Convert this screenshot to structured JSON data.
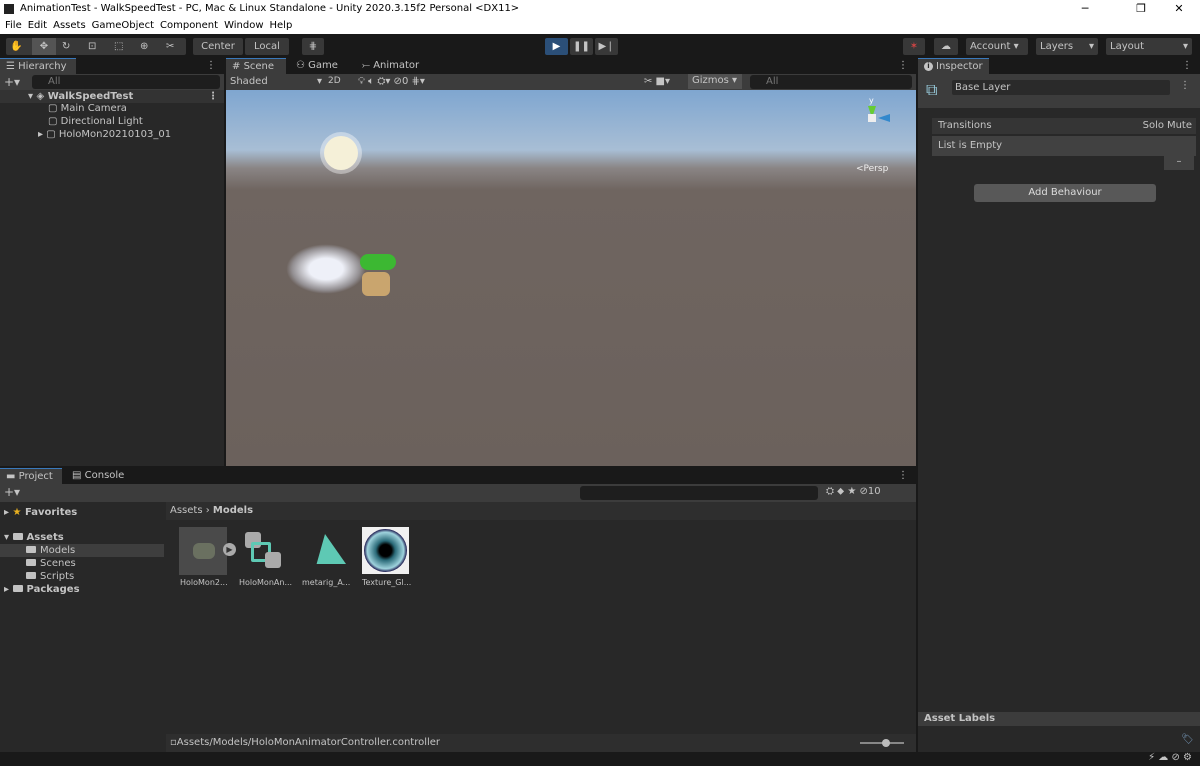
{
  "window": {
    "title": "AnimationTest - WalkSpeedTest - PC, Mac & Linux Standalone - Unity 2020.3.15f2 Personal <DX11>"
  },
  "menu": [
    "File",
    "Edit",
    "Assets",
    "GameObject",
    "Component",
    "Window",
    "Help"
  ],
  "toolbar": {
    "center": "Center",
    "local": "Local",
    "account": "Account",
    "layers": "Layers",
    "layout": "Layout"
  },
  "hierarchy": {
    "tab": "Hierarchy",
    "search_placeholder": "All",
    "scene": "WalkSpeedTest",
    "items": [
      "Main Camera",
      "Directional Light",
      "HoloMon20210103_01"
    ]
  },
  "scene": {
    "tabs": [
      "Scene",
      "Game",
      "Animator"
    ],
    "shading": "Shaded",
    "mode_2d": "2D",
    "hidden_count": "0",
    "gizmos": "Gizmos",
    "search_placeholder": "All",
    "persp": "<Persp",
    "gizmo_axis": "y"
  },
  "inspector": {
    "tab": "Inspector",
    "layer_name": "Base Layer",
    "transitions": "Transitions",
    "solo": "Solo",
    "mute": "Mute",
    "list_empty": "List is Empty",
    "minus": "–",
    "add_behaviour": "Add Behaviour",
    "asset_labels": "Asset Labels"
  },
  "project": {
    "tabs": [
      "Project",
      "Console"
    ],
    "favorites": "Favorites",
    "assets": "Assets",
    "folders": [
      "Models",
      "Scenes",
      "Scripts"
    ],
    "packages": "Packages",
    "breadcrumb_root": "Assets",
    "breadcrumb_current": "Models",
    "hidden_count": "10",
    "files": [
      "HoloMon2...",
      "HoloMonAn...",
      "metarig_A...",
      "Texture_Gl..."
    ],
    "status_path": "Assets/Models/HoloMonAnimatorController.controller"
  },
  "colors": {
    "accent": "#3a79bb",
    "play_active": "#2b4f78",
    "annotation": "#d42020"
  }
}
